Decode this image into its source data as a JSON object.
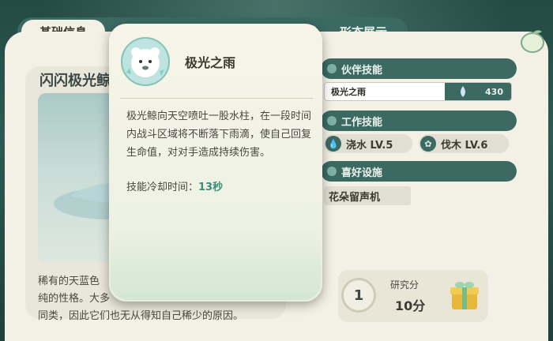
{
  "tabs": {
    "basic_info": "基础信息",
    "form_display": "形态展示"
  },
  "left": {
    "title": "闪闪极光鲸",
    "description_lines": [
      "稀有的天蓝色",
      "纯的性格。大多",
      "同类，因此它们也无从得知自己稀少的原因。"
    ]
  },
  "popup": {
    "title": "极光之雨",
    "description": "极光鲸向天空喷吐一股水柱，在一段时间内战斗区域将不断落下雨滴，使自己回复生命值，对对手造成持续伤害。",
    "cooldown_label": "技能冷却时间：",
    "cooldown_value": "13秒"
  },
  "right": {
    "partner_skill_header": "伙伴技能",
    "partner_skill_name": "极光之雨",
    "partner_skill_value": "430",
    "work_skill_header": "工作技能",
    "work_skills": [
      {
        "label": "浇水 LV.5",
        "icon": "water-drop-icon"
      },
      {
        "label": "伐木 LV.6",
        "icon": "leaf-axe-icon"
      }
    ],
    "favorite_header": "喜好设施",
    "favorite_facility": "花朵留声机",
    "research_level": "1",
    "research_label": "研究分",
    "research_value": "10分"
  },
  "colors": {
    "accent": "#3c6a63",
    "panel": "#f3f1e5",
    "cooldown": "#3d8c78"
  }
}
